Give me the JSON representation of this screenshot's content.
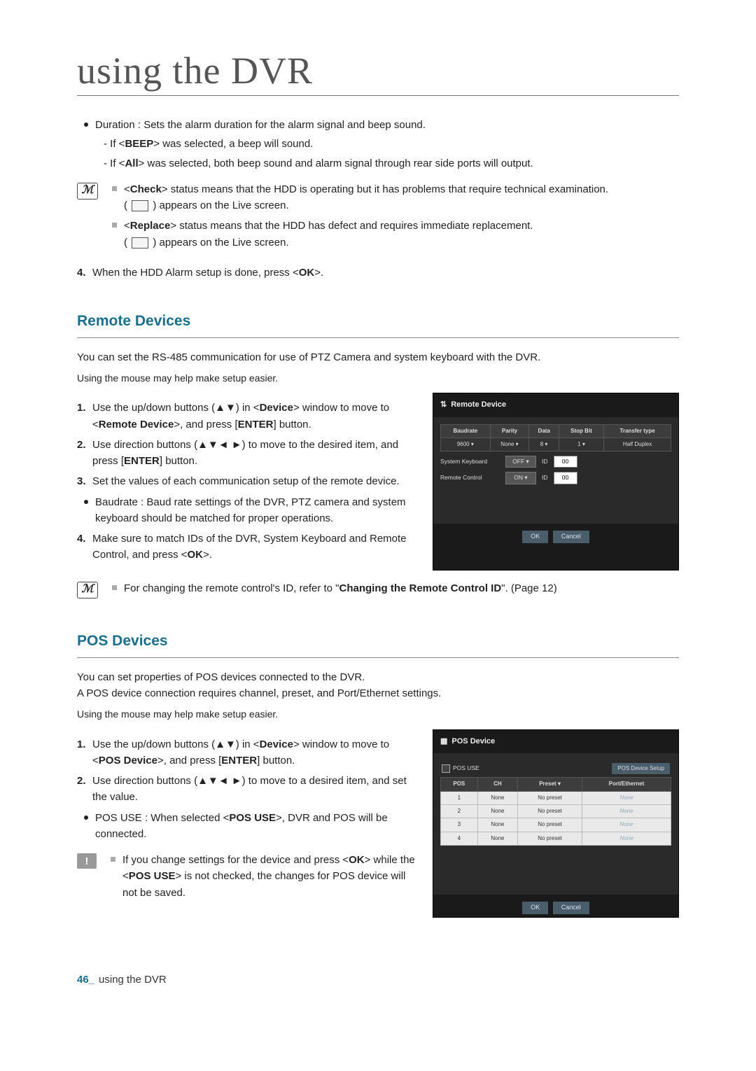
{
  "page_title": "using the DVR",
  "top_bullets": {
    "duration": "Duration : Sets the alarm duration for the alarm signal and beep sound.",
    "beep": "- If <BEEP> was selected, a beep will sound.",
    "all": "- If <All> was selected, both beep sound and alarm signal through rear side ports will output."
  },
  "note1": {
    "check": "<Check> status means that the HDD is operating but it has problems that require technical examination.",
    "check_tail": ") appears on the Live screen.",
    "replace": "<Replace> status means that the HDD has defect and requires immediate replacement.",
    "replace_tail": ") appears on the Live screen."
  },
  "step4_top": "When the HDD Alarm setup is done, press <OK>.",
  "section_remote": "Remote Devices",
  "remote_intro": "You can set the RS-485 communication for use of PTZ Camera and system keyboard with the DVR.",
  "mouse_hint": "Using the mouse may help make setup easier.",
  "remote_steps": {
    "s1": "Use the up/down buttons (▲▼) in <Device> window to move to <Remote Device>, and press [ENTER] button.",
    "s2": "Use direction buttons (▲▼◄ ►) to move to the desired item, and press [ENTER] button.",
    "s3": "Set the values of each communication setup of the remote device.",
    "baud": "Baudrate : Baud rate settings of the DVR, PTZ camera and system keyboard should be matched for proper operations.",
    "s4": "Make sure to match IDs of the DVR, System Keyboard and Remote Control, and press <OK>."
  },
  "remote_note": "For changing the remote control's ID, refer to \"Changing the Remote Control ID\". (Page 12)",
  "screenshot_remote": {
    "title": "Remote Device",
    "cols": [
      "Baudrate",
      "Parity",
      "Data",
      "Stop Bit",
      "Transfer type"
    ],
    "vals": [
      "9600",
      "None",
      "8",
      "1",
      "Half Duplex"
    ],
    "sys_kbd": "System Keyboard",
    "sys_kbd_v": "OFF",
    "id_lbl": "ID",
    "sys_id": "00",
    "rc": "Remote Control",
    "rc_v": "ON",
    "rc_id": "00",
    "ok": "OK",
    "cancel": "Cancel"
  },
  "section_pos": "POS Devices",
  "pos_intro1": "You can set properties of POS devices connected to the DVR.",
  "pos_intro2": "A POS device connection requires channel, preset, and Port/Ethernet settings.",
  "pos_steps": {
    "s1": "Use the up/down buttons (▲▼) in <Device> window to move to <POS Device>, and press [ENTER] button.",
    "s2": "Use direction buttons (▲▼◄ ►) to move to a desired item, and set the value.",
    "posuse": "POS USE : When selected <POS USE>, DVR and POS will be connected."
  },
  "pos_warn": "If you change settings for the device and press <OK> while the <POS USE> is not checked, the changes for POS device will not be saved.",
  "screenshot_pos": {
    "title": "POS Device",
    "posuse_lbl": "POS USE",
    "setup_btn": "POS Device Setup",
    "cols": [
      "POS",
      "CH",
      "Preset ▾",
      "Port/Ethernet"
    ],
    "rows": [
      {
        "pos": "1",
        "ch": "None",
        "preset": "No preset",
        "pe": "None"
      },
      {
        "pos": "2",
        "ch": "None",
        "preset": "No preset",
        "pe": "None"
      },
      {
        "pos": "3",
        "ch": "None",
        "preset": "No preset",
        "pe": "None"
      },
      {
        "pos": "4",
        "ch": "None",
        "preset": "No preset",
        "pe": "None"
      }
    ],
    "ok": "OK",
    "cancel": "Cancel"
  },
  "footer": {
    "page_num": "46_",
    "label": "using the DVR"
  }
}
